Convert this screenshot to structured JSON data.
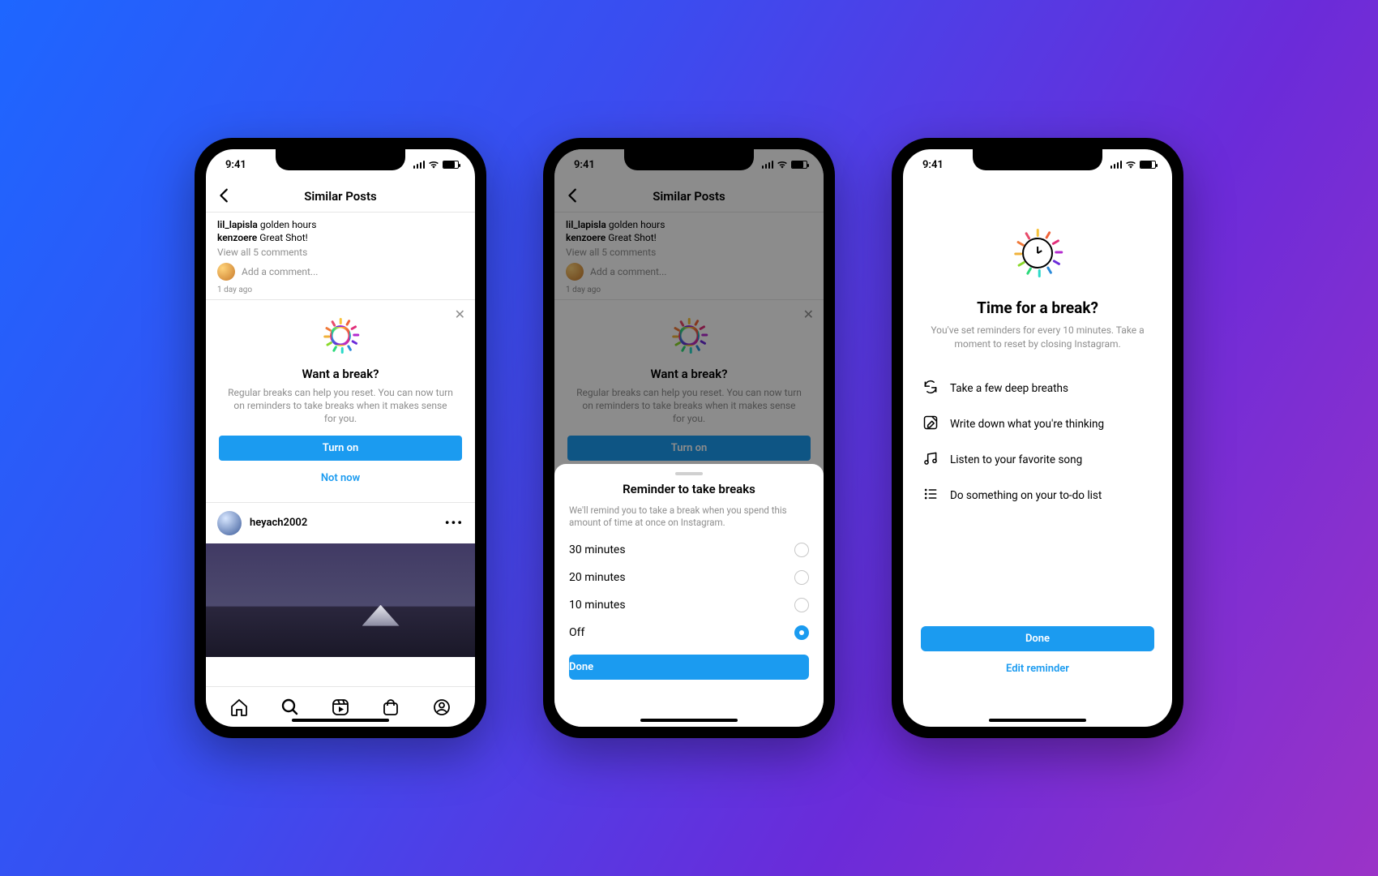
{
  "status": {
    "time": "9:41"
  },
  "header": {
    "title": "Similar Posts"
  },
  "comments": {
    "rows": [
      {
        "user": "lil_lapisla",
        "text": "golden hours"
      },
      {
        "user": "kenzoere",
        "text": "Great Shot!"
      }
    ],
    "view_all": "View all 5 comments",
    "add_placeholder": "Add a comment...",
    "timestamp": "1 day ago"
  },
  "break_card": {
    "title": "Want a break?",
    "desc": "Regular breaks can help you reset. You can now turn on reminders to take breaks when it makes sense for you.",
    "primary": "Turn on",
    "secondary": "Not now"
  },
  "post": {
    "user": "heyach2002"
  },
  "sheet": {
    "title": "Reminder to take breaks",
    "desc": "We'll remind you to take a break when you spend this amount of time at once on Instagram.",
    "options": [
      {
        "label": "30 minutes",
        "selected": false
      },
      {
        "label": "20 minutes",
        "selected": false
      },
      {
        "label": "10 minutes",
        "selected": false
      },
      {
        "label": "Off",
        "selected": true
      }
    ],
    "done": "Done"
  },
  "break_screen": {
    "title": "Time for a break?",
    "sub": "You've set reminders for every 10 minutes. Take a moment to reset by closing Instagram.",
    "tips": [
      "Take a few deep breaths",
      "Write down what you're thinking",
      "Listen to your favorite song",
      "Do something on your to-do list"
    ],
    "done": "Done",
    "edit": "Edit reminder"
  },
  "tick_colors": [
    "#f8c23a",
    "#f0643a",
    "#e12f7a",
    "#b42bcf",
    "#6b2bd9",
    "#2b8ad9",
    "#2bd9c8",
    "#2bd97a",
    "#8ad92b",
    "#f0b23a",
    "#f07a3a",
    "#e84a6a"
  ]
}
